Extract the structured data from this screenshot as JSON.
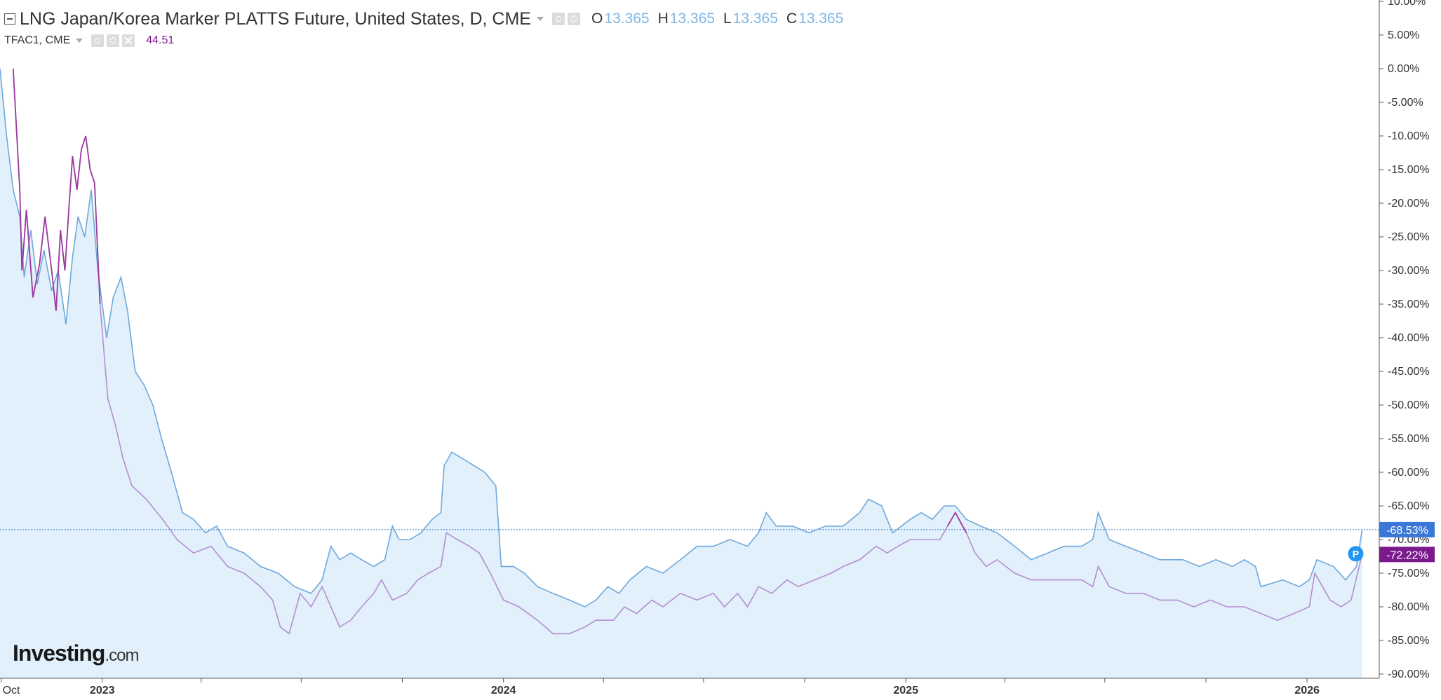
{
  "legend": {
    "main_title": "LNG Japan/Korea Marker PLATTS Future, United States, D, CME",
    "o_label": "O",
    "o_value": "13.365",
    "h_label": "H",
    "h_value": "13.365",
    "l_label": "L",
    "l_value": "13.365",
    "c_label": "C",
    "c_value": "13.365",
    "compare_symbol": "TFAC1, CME",
    "compare_value": "44.51"
  },
  "watermark": {
    "brand": "Investing",
    "suffix": ".com"
  },
  "badge_letter": "P",
  "chart_data": {
    "type": "area",
    "title": "LNG Japan/Korea Marker PLATTS Future, United States, D, CME",
    "xlabel": "",
    "ylabel": "",
    "y_unit": "%",
    "ylim": [
      -91,
      10
    ],
    "y_ticks": [
      "10.00%",
      "5.00%",
      "0.00%",
      "-5.00%",
      "-10.00%",
      "-15.00%",
      "-20.00%",
      "-25.00%",
      "-30.00%",
      "-35.00%",
      "-40.00%",
      "-45.00%",
      "-50.00%",
      "-55.00%",
      "-60.00%",
      "-65.00%",
      "-70.00%",
      "-75.00%",
      "-80.00%",
      "-85.00%",
      "-90.00%"
    ],
    "x_range": [
      "2022-09-30",
      "2026-02-28"
    ],
    "x_labels": [
      {
        "date": "2022-10-01",
        "label": "Oct",
        "bold": false
      },
      {
        "date": "2023-01-01",
        "label": "2023",
        "bold": true
      },
      {
        "date": "2024-01-01",
        "label": "2024",
        "bold": true
      },
      {
        "date": "2025-01-01",
        "label": "2025",
        "bold": true
      },
      {
        "date": "2026-01-01",
        "label": "2026",
        "bold": true
      }
    ],
    "x_minor_ticks": [
      "2023-04-01",
      "2023-07-01",
      "2023-10-01",
      "2024-04-01",
      "2024-07-01",
      "2024-10-01",
      "2025-04-01",
      "2025-07-01",
      "2025-10-01"
    ],
    "grid": false,
    "reference_line": {
      "value": -68.53
    },
    "series": [
      {
        "name": "LNG Japan/Korea Marker PLATTS Future",
        "color": "#6fa8dc",
        "fill": "#e1f0fa",
        "last_label": "-68.53%",
        "label_color": "#3a78d8",
        "points": [
          [
            "2022-09-30",
            0
          ],
          [
            "2022-10-06",
            -10
          ],
          [
            "2022-10-12",
            -18
          ],
          [
            "2022-10-18",
            -22
          ],
          [
            "2022-10-22",
            -31
          ],
          [
            "2022-10-28",
            -24
          ],
          [
            "2022-11-03",
            -32
          ],
          [
            "2022-11-09",
            -27
          ],
          [
            "2022-11-16",
            -33
          ],
          [
            "2022-11-22",
            -30
          ],
          [
            "2022-11-29",
            -38
          ],
          [
            "2022-12-05",
            -28
          ],
          [
            "2022-12-10",
            -22
          ],
          [
            "2022-12-16",
            -25
          ],
          [
            "2022-12-22",
            -18
          ],
          [
            "2022-12-28",
            -30
          ],
          [
            "2023-01-05",
            -40
          ],
          [
            "2023-01-11",
            -34
          ],
          [
            "2023-01-18",
            -31
          ],
          [
            "2023-01-24",
            -36
          ],
          [
            "2023-01-31",
            -45
          ],
          [
            "2023-02-08",
            -47
          ],
          [
            "2023-02-16",
            -50
          ],
          [
            "2023-02-24",
            -55
          ],
          [
            "2023-03-05",
            -60
          ],
          [
            "2023-03-15",
            -66
          ],
          [
            "2023-03-25",
            -67
          ],
          [
            "2023-04-05",
            -69
          ],
          [
            "2023-04-15",
            -68
          ],
          [
            "2023-04-25",
            -71
          ],
          [
            "2023-05-10",
            -72
          ],
          [
            "2023-05-25",
            -74
          ],
          [
            "2023-06-10",
            -75
          ],
          [
            "2023-06-25",
            -77
          ],
          [
            "2023-07-10",
            -78
          ],
          [
            "2023-07-20",
            -76
          ],
          [
            "2023-07-28",
            -71
          ],
          [
            "2023-08-05",
            -73
          ],
          [
            "2023-08-15",
            -72
          ],
          [
            "2023-08-25",
            -73
          ],
          [
            "2023-09-05",
            -74
          ],
          [
            "2023-09-15",
            -73
          ],
          [
            "2023-09-22",
            -68
          ],
          [
            "2023-09-28",
            -70
          ],
          [
            "2023-10-08",
            -70
          ],
          [
            "2023-10-18",
            -69
          ],
          [
            "2023-10-28",
            -67
          ],
          [
            "2023-11-05",
            -66
          ],
          [
            "2023-11-08",
            -59
          ],
          [
            "2023-11-15",
            -57
          ],
          [
            "2023-11-25",
            -58
          ],
          [
            "2023-12-05",
            -59
          ],
          [
            "2023-12-15",
            -60
          ],
          [
            "2023-12-25",
            -62
          ],
          [
            "2023-12-30",
            -74
          ],
          [
            "2024-01-10",
            -74
          ],
          [
            "2024-01-20",
            -75
          ],
          [
            "2024-02-01",
            -77
          ],
          [
            "2024-02-15",
            -78
          ],
          [
            "2024-03-01",
            -79
          ],
          [
            "2024-03-15",
            -80
          ],
          [
            "2024-03-25",
            -79
          ],
          [
            "2024-04-05",
            -77
          ],
          [
            "2024-04-15",
            -78
          ],
          [
            "2024-04-25",
            -76
          ],
          [
            "2024-05-10",
            -74
          ],
          [
            "2024-05-25",
            -75
          ],
          [
            "2024-06-10",
            -73
          ],
          [
            "2024-06-25",
            -71
          ],
          [
            "2024-07-10",
            -71
          ],
          [
            "2024-07-25",
            -70
          ],
          [
            "2024-08-10",
            -71
          ],
          [
            "2024-08-20",
            -69
          ],
          [
            "2024-08-27",
            -66
          ],
          [
            "2024-09-05",
            -68
          ],
          [
            "2024-09-20",
            -68
          ],
          [
            "2024-10-05",
            -69
          ],
          [
            "2024-10-20",
            -68
          ],
          [
            "2024-11-05",
            -68
          ],
          [
            "2024-11-20",
            -66
          ],
          [
            "2024-11-28",
            -64
          ],
          [
            "2024-12-10",
            -65
          ],
          [
            "2024-12-20",
            -69
          ],
          [
            "2025-01-05",
            -67
          ],
          [
            "2025-01-15",
            -66
          ],
          [
            "2025-01-25",
            -67
          ],
          [
            "2025-02-05",
            -65
          ],
          [
            "2025-02-15",
            -65
          ],
          [
            "2025-02-25",
            -67
          ],
          [
            "2025-03-10",
            -68
          ],
          [
            "2025-03-25",
            -69
          ],
          [
            "2025-04-10",
            -71
          ],
          [
            "2025-04-25",
            -73
          ],
          [
            "2025-05-10",
            -72
          ],
          [
            "2025-05-25",
            -71
          ],
          [
            "2025-06-10",
            -71
          ],
          [
            "2025-06-20",
            -70
          ],
          [
            "2025-06-25",
            -66
          ],
          [
            "2025-07-05",
            -70
          ],
          [
            "2025-07-20",
            -71
          ],
          [
            "2025-08-05",
            -72
          ],
          [
            "2025-08-20",
            -73
          ],
          [
            "2025-09-10",
            -73
          ],
          [
            "2025-09-25",
            -74
          ],
          [
            "2025-10-10",
            -73
          ],
          [
            "2025-10-25",
            -74
          ],
          [
            "2025-11-05",
            -73
          ],
          [
            "2025-11-15",
            -74
          ],
          [
            "2025-11-20",
            -77
          ],
          [
            "2025-12-10",
            -76
          ],
          [
            "2025-12-25",
            -77
          ],
          [
            "2026-01-03",
            -76
          ],
          [
            "2026-01-10",
            -73
          ],
          [
            "2026-01-25",
            -74
          ],
          [
            "2026-02-05",
            -76
          ],
          [
            "2026-02-15",
            -74
          ],
          [
            "2026-02-20",
            -68.53
          ]
        ]
      },
      {
        "name": "TFAC1, CME",
        "color": "#b48fd0",
        "color_early": "#9c3aa0",
        "last_label": "-72.22%",
        "label_color": "#7b1a8c",
        "points": [
          [
            "2022-10-12",
            0
          ],
          [
            "2022-10-18",
            -18
          ],
          [
            "2022-10-20",
            -30
          ],
          [
            "2022-10-24",
            -21
          ],
          [
            "2022-10-30",
            -34
          ],
          [
            "2022-11-05",
            -29
          ],
          [
            "2022-11-10",
            -22
          ],
          [
            "2022-11-16",
            -30
          ],
          [
            "2022-11-20",
            -36
          ],
          [
            "2022-11-24",
            -24
          ],
          [
            "2022-11-28",
            -30
          ],
          [
            "2022-12-02",
            -20
          ],
          [
            "2022-12-05",
            -13
          ],
          [
            "2022-12-09",
            -18
          ],
          [
            "2022-12-13",
            -12
          ],
          [
            "2022-12-17",
            -10
          ],
          [
            "2022-12-21",
            -15
          ],
          [
            "2022-12-25",
            -17
          ],
          [
            "2022-12-30",
            -35
          ],
          [
            "2023-01-06",
            -49
          ],
          [
            "2023-01-13",
            -53
          ],
          [
            "2023-01-20",
            -58
          ],
          [
            "2023-01-28",
            -62
          ],
          [
            "2023-02-10",
            -64
          ],
          [
            "2023-02-25",
            -67
          ],
          [
            "2023-03-10",
            -70
          ],
          [
            "2023-03-25",
            -72
          ],
          [
            "2023-04-10",
            -71
          ],
          [
            "2023-04-25",
            -74
          ],
          [
            "2023-05-10",
            -75
          ],
          [
            "2023-05-25",
            -77
          ],
          [
            "2023-06-05",
            -79
          ],
          [
            "2023-06-12",
            -83
          ],
          [
            "2023-06-20",
            -84
          ],
          [
            "2023-06-30",
            -78
          ],
          [
            "2023-07-10",
            -80
          ],
          [
            "2023-07-20",
            -77
          ],
          [
            "2023-07-28",
            -80
          ],
          [
            "2023-08-05",
            -83
          ],
          [
            "2023-08-15",
            -82
          ],
          [
            "2023-08-25",
            -80
          ],
          [
            "2023-09-05",
            -78
          ],
          [
            "2023-09-12",
            -76
          ],
          [
            "2023-09-22",
            -79
          ],
          [
            "2023-10-05",
            -78
          ],
          [
            "2023-10-15",
            -76
          ],
          [
            "2023-10-25",
            -75
          ],
          [
            "2023-11-05",
            -74
          ],
          [
            "2023-11-10",
            -69
          ],
          [
            "2023-11-20",
            -70
          ],
          [
            "2023-12-01",
            -71
          ],
          [
            "2023-12-10",
            -72
          ],
          [
            "2023-12-20",
            -75
          ],
          [
            "2024-01-01",
            -79
          ],
          [
            "2024-01-15",
            -80
          ],
          [
            "2024-02-01",
            -82
          ],
          [
            "2024-02-15",
            -84
          ],
          [
            "2024-03-01",
            -84
          ],
          [
            "2024-03-15",
            -83
          ],
          [
            "2024-03-25",
            -82
          ],
          [
            "2024-04-10",
            -82
          ],
          [
            "2024-04-20",
            -80
          ],
          [
            "2024-05-01",
            -81
          ],
          [
            "2024-05-15",
            -79
          ],
          [
            "2024-05-25",
            -80
          ],
          [
            "2024-06-10",
            -78
          ],
          [
            "2024-06-25",
            -79
          ],
          [
            "2024-07-10",
            -78
          ],
          [
            "2024-07-20",
            -80
          ],
          [
            "2024-08-01",
            -78
          ],
          [
            "2024-08-10",
            -80
          ],
          [
            "2024-08-20",
            -77
          ],
          [
            "2024-09-01",
            -78
          ],
          [
            "2024-09-15",
            -76
          ],
          [
            "2024-09-25",
            -77
          ],
          [
            "2024-10-10",
            -76
          ],
          [
            "2024-10-25",
            -75
          ],
          [
            "2024-11-05",
            -74
          ],
          [
            "2024-11-20",
            -73
          ],
          [
            "2024-12-05",
            -71
          ],
          [
            "2024-12-15",
            -72
          ],
          [
            "2024-12-25",
            -71
          ],
          [
            "2025-01-05",
            -70
          ],
          [
            "2025-01-20",
            -70
          ],
          [
            "2025-02-01",
            -70
          ],
          [
            "2025-02-08",
            -68
          ],
          [
            "2025-02-15",
            -66
          ],
          [
            "2025-02-25",
            -69
          ],
          [
            "2025-03-05",
            -72
          ],
          [
            "2025-03-15",
            -74
          ],
          [
            "2025-03-25",
            -73
          ],
          [
            "2025-04-10",
            -75
          ],
          [
            "2025-04-25",
            -76
          ],
          [
            "2025-05-10",
            -76
          ],
          [
            "2025-05-25",
            -76
          ],
          [
            "2025-06-10",
            -76
          ],
          [
            "2025-06-20",
            -77
          ],
          [
            "2025-06-25",
            -74
          ],
          [
            "2025-07-05",
            -77
          ],
          [
            "2025-07-20",
            -78
          ],
          [
            "2025-08-05",
            -78
          ],
          [
            "2025-08-20",
            -79
          ],
          [
            "2025-09-05",
            -79
          ],
          [
            "2025-09-20",
            -80
          ],
          [
            "2025-10-05",
            -79
          ],
          [
            "2025-10-20",
            -80
          ],
          [
            "2025-11-05",
            -80
          ],
          [
            "2025-11-20",
            -81
          ],
          [
            "2025-12-05",
            -82
          ],
          [
            "2025-12-20",
            -81
          ],
          [
            "2026-01-03",
            -80
          ],
          [
            "2026-01-08",
            -75
          ],
          [
            "2026-01-15",
            -77
          ],
          [
            "2026-01-22",
            -79
          ],
          [
            "2026-02-01",
            -80
          ],
          [
            "2026-02-10",
            -79
          ],
          [
            "2026-02-20",
            -72.22
          ]
        ]
      }
    ]
  }
}
